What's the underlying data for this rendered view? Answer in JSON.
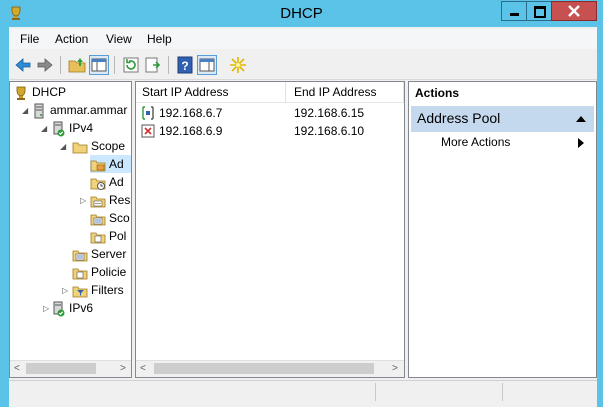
{
  "window": {
    "title": "DHCP"
  },
  "menu": [
    "File",
    "Action",
    "View",
    "Help"
  ],
  "tree": {
    "root": "DHCP",
    "server": "ammar.ammar",
    "ipv4": "IPv4",
    "scope": "Scope",
    "scope_children": [
      "Ad",
      "Ad",
      "Res",
      "Sco",
      "Pol"
    ],
    "server_options": "Server",
    "policies": "Policie",
    "filters": "Filters",
    "ipv6": "IPv6"
  },
  "list": {
    "columns": [
      "Start IP Address",
      "End IP Address"
    ],
    "rows": [
      {
        "start": "192.168.6.7",
        "end": "192.168.6.15",
        "type": "range"
      },
      {
        "start": "192.168.6.9",
        "end": "192.168.6.10",
        "type": "exclusion"
      }
    ]
  },
  "actions": {
    "title": "Actions",
    "section": "Address Pool",
    "items": [
      "More Actions"
    ]
  },
  "icons": {
    "titlebar": "dhcp-trophy-icon",
    "toolbar": [
      "back-icon",
      "forward-icon",
      "up-folder-icon",
      "show-hide-tree-icon",
      "refresh-icon",
      "export-list-icon",
      "help-icon",
      "properties-icon",
      "new-star-icon"
    ]
  },
  "colors": {
    "titlebar": "#5bc3e8",
    "close_button": "#c75050",
    "actions_section": "#c5d9ee"
  }
}
